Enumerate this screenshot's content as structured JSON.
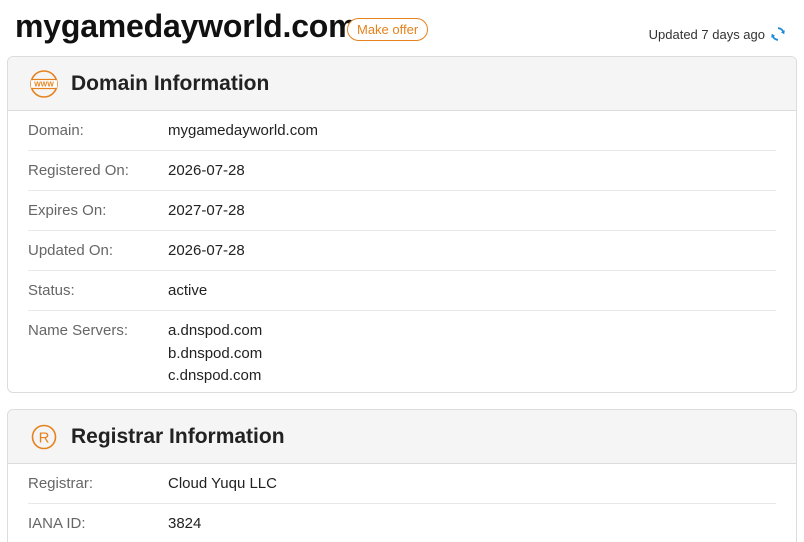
{
  "header": {
    "domain": "mygamedayworld.com",
    "offer_label": "Make offer",
    "updated_text": "Updated 7 days ago"
  },
  "domain_info": {
    "title": "Domain Information",
    "icon": "www-icon",
    "rows": {
      "domain": {
        "label": "Domain:",
        "value": "mygamedayworld.com"
      },
      "registered": {
        "label": "Registered On:",
        "value": "2026-07-28"
      },
      "expires": {
        "label": "Expires On:",
        "value": "2027-07-28"
      },
      "updated": {
        "label": "Updated On:",
        "value": "2026-07-28"
      },
      "status": {
        "label": "Status:",
        "value": "active"
      },
      "name_servers": {
        "label": "Name Servers:",
        "values": [
          "a.dnspod.com",
          "b.dnspod.com",
          "c.dnspod.com"
        ]
      }
    }
  },
  "registrar_info": {
    "title": "Registrar Information",
    "icon": "registered-icon",
    "rows": {
      "registrar": {
        "label": "Registrar:",
        "value": "Cloud Yuqu LLC"
      },
      "iana_id": {
        "label": "IANA ID:",
        "value": "3824"
      }
    }
  },
  "colors": {
    "accent": "#e5821e",
    "refresh_icon": "#1a8ad8"
  }
}
